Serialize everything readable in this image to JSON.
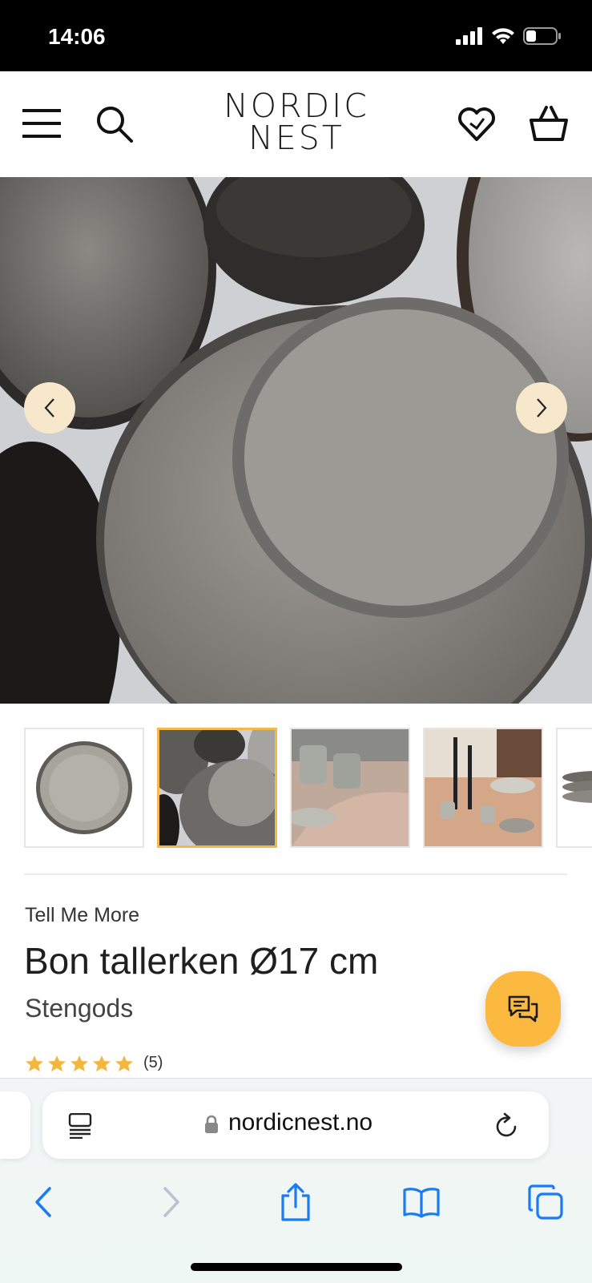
{
  "status_bar": {
    "time": "14:06"
  },
  "header": {
    "logo_line1": "NORDIC",
    "logo_line2": "NEST"
  },
  "gallery": {
    "thumbnail_count": 5,
    "active_index": 1
  },
  "product": {
    "brand": "Tell Me More",
    "title": "Bon tallerken Ø17 cm",
    "material": "Stengods",
    "rating_stars": 5,
    "review_count": "(5)"
  },
  "browser": {
    "url": "nordicnest.no"
  },
  "colors": {
    "accent": "#fbb93f",
    "active_border": "#f3b94a",
    "link_blue": "#1a7cf5"
  }
}
